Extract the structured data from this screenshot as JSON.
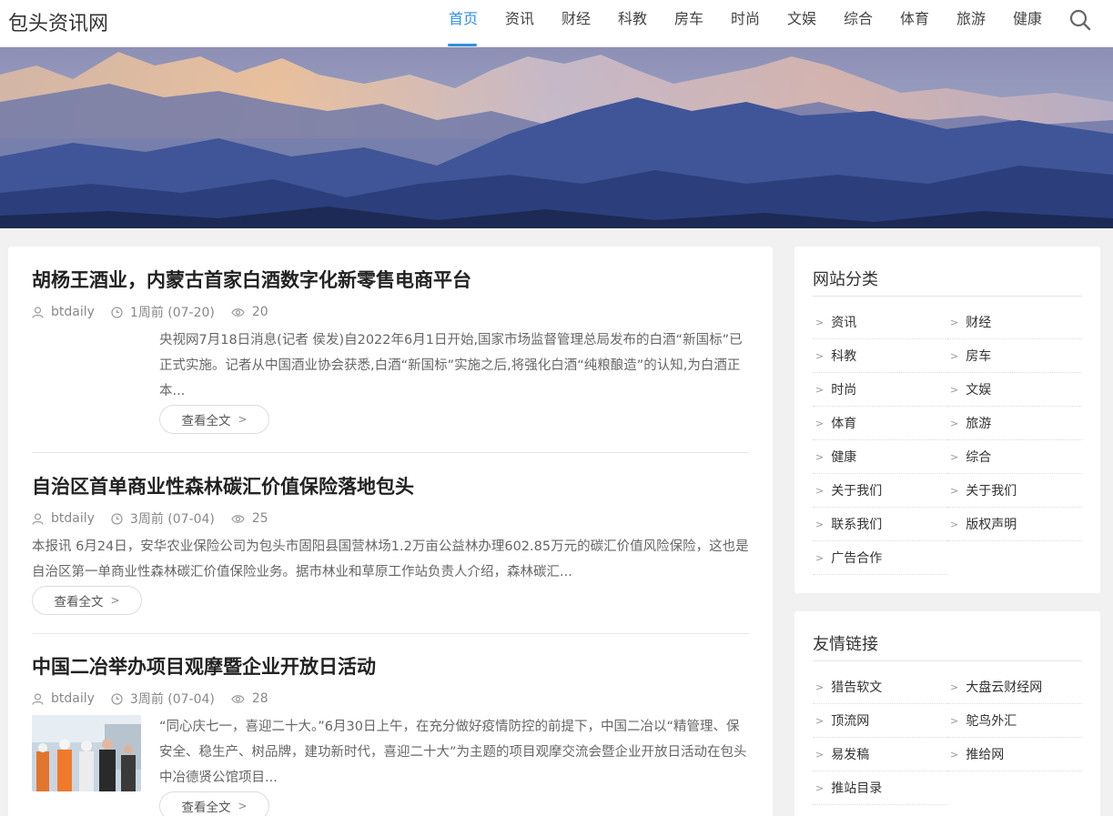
{
  "site": {
    "logo": "包头资讯网"
  },
  "nav": [
    {
      "label": "首页",
      "active": true
    },
    {
      "label": "资讯"
    },
    {
      "label": "财经"
    },
    {
      "label": "科教"
    },
    {
      "label": "房车"
    },
    {
      "label": "时尚"
    },
    {
      "label": "文娱"
    },
    {
      "label": "综合"
    },
    {
      "label": "体育"
    },
    {
      "label": "旅游"
    },
    {
      "label": "健康"
    }
  ],
  "posts": [
    {
      "title": "胡杨王酒业，内蒙古首家白酒数字化新零售电商平台",
      "author": "btdaily",
      "time": "1周前 (07-20)",
      "views": "20",
      "excerpt": "央视网7月18日消息(记者 侯发)自2022年6月1日开始,国家市场监督管理总局发布的白酒“新国标”已正式实施。记者从中国酒业协会获悉,白酒“新国标”实施之后,将强化白酒“纯粮酿造”的认知,为白酒正本...",
      "more": "查看全文"
    },
    {
      "title": "自治区首单商业性森林碳汇价值保险落地包头",
      "author": "btdaily",
      "time": "3周前 (07-04)",
      "views": "25",
      "excerpt": "本报讯 6月24日，安华农业保险公司为包头市固阳县国营林场1.2万亩公益林办理602.85万元的碳汇价值风险保险，这也是自治区第一单商业性森林碳汇价值保险业务。据市林业和草原工作站负责人介绍，森林碳汇...",
      "more": "查看全文"
    },
    {
      "title": "中国二冶举办项目观摩暨企业开放日活动",
      "author": "btdaily",
      "time": "3周前 (07-04)",
      "views": "28",
      "excerpt": "“同心庆七一，喜迎二十大。”6月30日上午，在充分做好疫情防控的前提下，中国二冶以“精管理、保安全、稳生产、树品牌，建功新时代，喜迎二十大”为主题的项目观摩交流会暨企业开放日活动在包头中冶德贤公馆项目...",
      "more": "查看全文"
    }
  ],
  "categories": {
    "title": "网站分类",
    "items": [
      "资讯",
      "财经",
      "科教",
      "房车",
      "时尚",
      "文娱",
      "体育",
      "旅游",
      "健康",
      "综合",
      "关于我们",
      "关于我们",
      "联系我们",
      "版权声明",
      "广告合作"
    ]
  },
  "links": {
    "title": "友情链接",
    "items": [
      "猎告软文",
      "大盘云财经网",
      "顶流网",
      "鸵鸟外汇",
      "易发稿",
      "推给网",
      "推站目录"
    ]
  },
  "colors": {
    "accent": "#2f8fe0"
  }
}
